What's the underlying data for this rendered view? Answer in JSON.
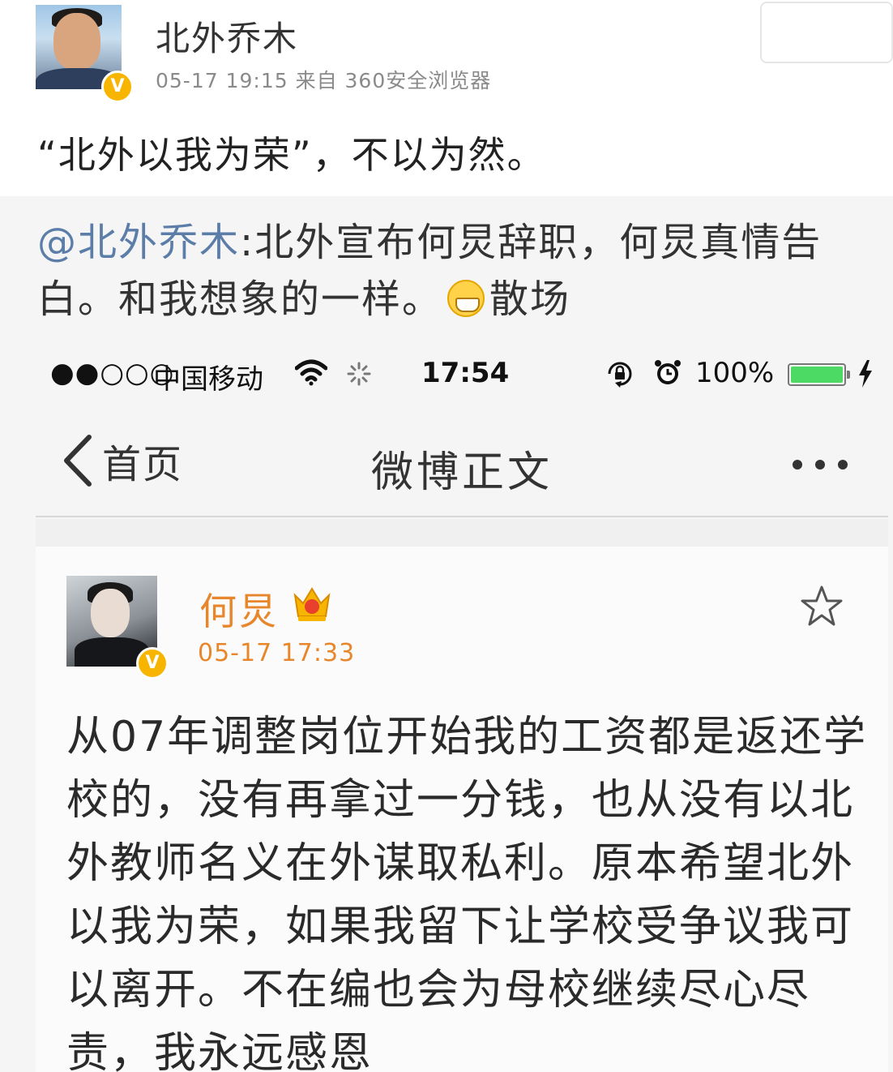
{
  "outer_post": {
    "author": "北外乔木",
    "meta": "05-17 19:15  来自 360安全浏览器",
    "verified_badge": "V",
    "text": "“北外以我为荣”，不以为然。"
  },
  "retweet": {
    "mention": "@北外乔木",
    "text_part1": ":北外宣布何炅辞职，何炅真情告白。和我想象的一样。",
    "emoji": "grin-icon",
    "text_part2": "散场"
  },
  "phone": {
    "statusbar": {
      "signal": "●●○○○",
      "carrier": "中国移动",
      "time": "17:54",
      "battery": "100%",
      "battery_color": "#4cd964"
    },
    "navbar": {
      "back_label": "首页",
      "title": "微博正文",
      "more_label": "•••"
    },
    "post": {
      "author": "何炅",
      "author_color": "#e8862b",
      "verified_badge": "V",
      "time": "05-17 17:33",
      "body": "从07年调整岗位开始我的工资都是返还学校的，没有再拿过一分钱，也从没有以北外教师名义在外谋取私利。原本希望北外以我为荣，如果我留下让学校受争议我可以离开。不在编也会为母校继续尽心尽责，我永远感恩"
    }
  }
}
